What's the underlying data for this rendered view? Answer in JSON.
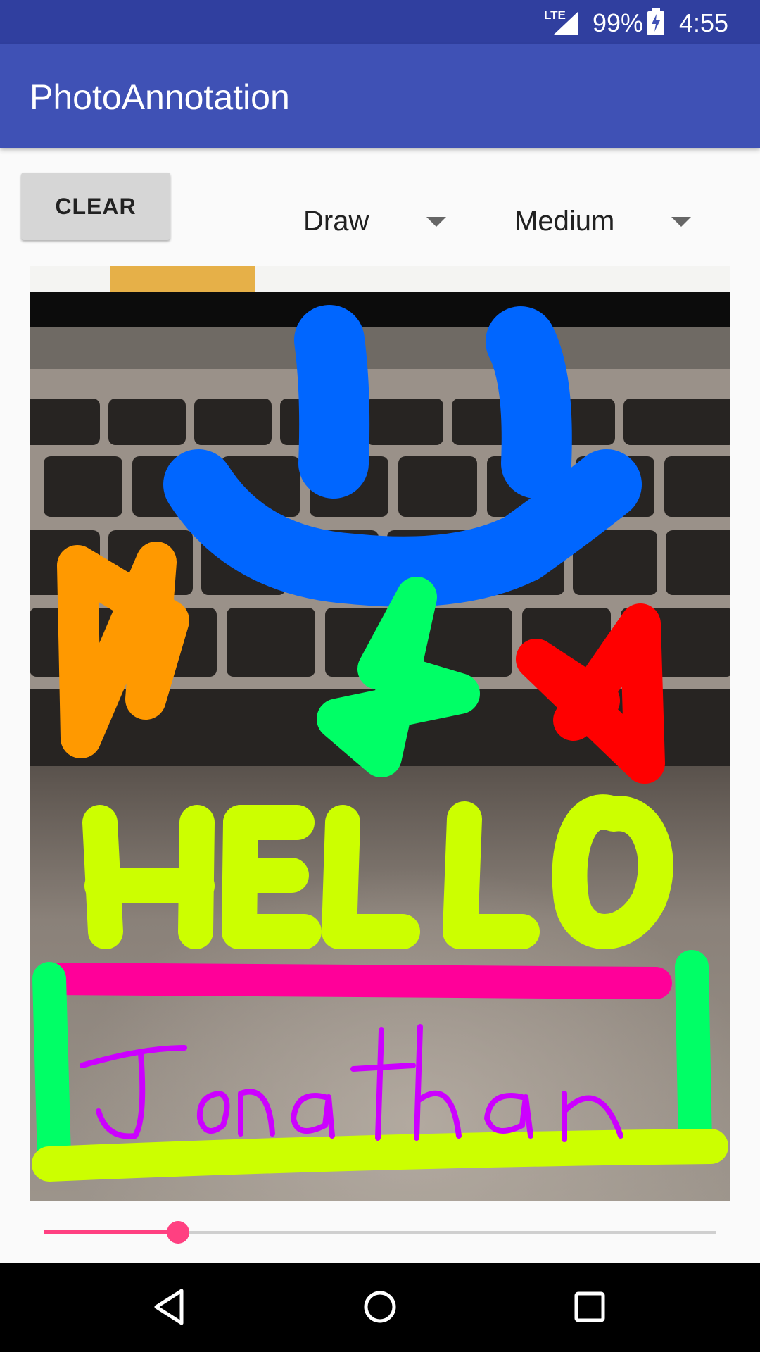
{
  "status_bar": {
    "network": "LTE",
    "battery_percent": "99%",
    "time": "4:55",
    "icons": [
      "signal-icon",
      "battery-charging-icon"
    ]
  },
  "app_bar": {
    "title": "PhotoAnnotation"
  },
  "toolbar": {
    "clear_label": "CLEAR",
    "mode": {
      "selected": "Draw"
    },
    "size": {
      "selected": "Medium"
    }
  },
  "canvas": {
    "photo": "keyboard-photo",
    "annotations": [
      {
        "kind": "smiley",
        "color": "#0066ff"
      },
      {
        "kind": "star",
        "color": "#ff9900"
      },
      {
        "kind": "star",
        "color": "#00ff66"
      },
      {
        "kind": "star",
        "color": "#ff0000"
      },
      {
        "kind": "text",
        "text": "HELLO",
        "color": "#ccff00"
      },
      {
        "kind": "underline",
        "color": "#ff0099"
      },
      {
        "kind": "box",
        "color": "#00ff66"
      },
      {
        "kind": "text",
        "text": "Jonathan",
        "color": "#cc00ff"
      }
    ]
  },
  "slider": {
    "value_fraction": 0.2,
    "color": "#ff4081"
  },
  "nav_bar": {
    "icons": [
      "back-icon",
      "home-icon",
      "recents-icon"
    ]
  }
}
